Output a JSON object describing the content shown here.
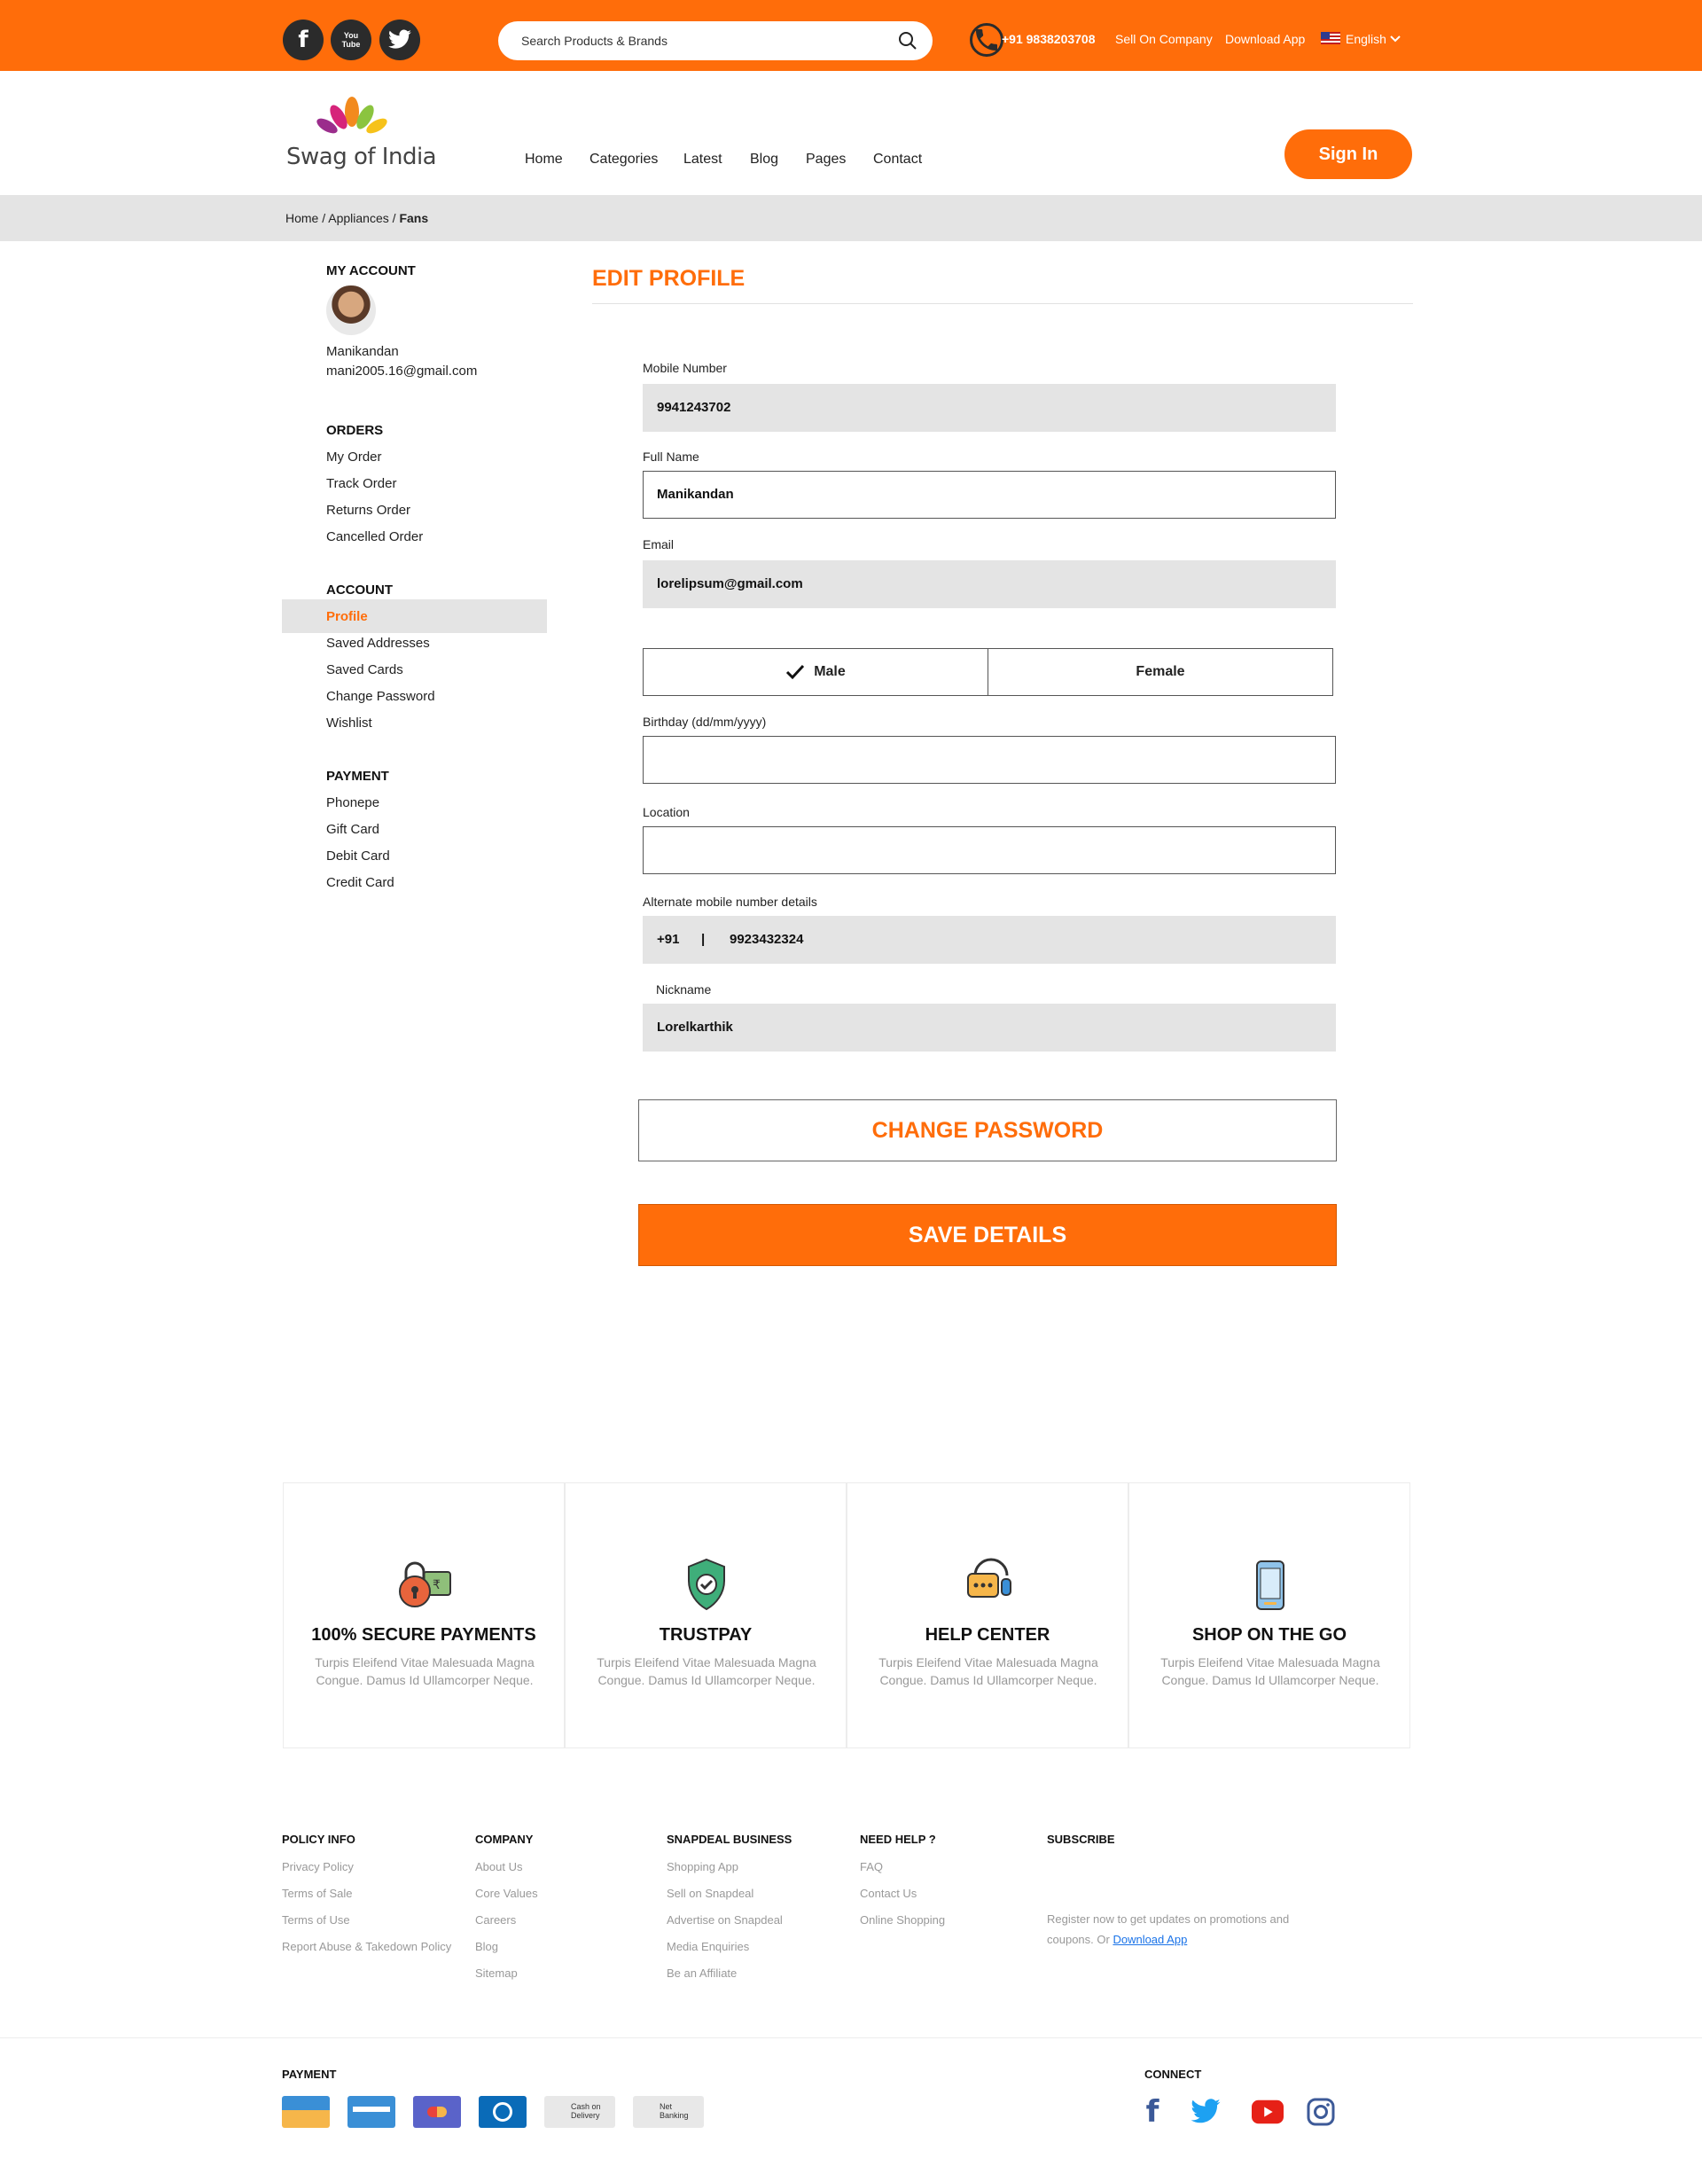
{
  "colors": {
    "brand": "#ff6d0a",
    "dark": "#2b2b2b",
    "field_bg": "#e4e4e4"
  },
  "topbar": {
    "social": [
      {
        "icon": "facebook-icon",
        "glyph": "f"
      },
      {
        "icon": "youtube-icon",
        "glyph": "You Tube"
      },
      {
        "icon": "twitter-icon",
        "glyph": "t"
      }
    ],
    "search_placeholder": "Search Products & Brands",
    "phone": "+91 9838203708",
    "sell": "Sell On Company",
    "download": "Download App",
    "language": "English"
  },
  "header": {
    "logo_text": "Swag of India",
    "nav": [
      "Home",
      "Categories",
      "Latest",
      "Blog",
      "Pages",
      "Contact"
    ],
    "signin": "Sign In"
  },
  "breadcrumb": {
    "home": "Home",
    "sep": " / ",
    "section": "Appliances",
    "current": "Fans"
  },
  "sidebar": {
    "my_account": "MY ACCOUNT",
    "user_name": "Manikandan",
    "user_email": "mani2005.16@gmail.com",
    "orders_heading": "ORDERS",
    "orders": [
      "My Order",
      "Track Order",
      "Returns Order",
      "Cancelled Order"
    ],
    "account_heading": "ACCOUNT",
    "account": [
      "Profile",
      "Saved Addresses",
      "Saved Cards",
      "Change Password",
      "Wishlist"
    ],
    "payment_heading": "PAYMENT",
    "payment": [
      "Phonepe",
      "Gift Card",
      "Debit Card",
      "Credit Card"
    ]
  },
  "form": {
    "title": "EDIT PROFILE",
    "mobile_label": "Mobile Number",
    "mobile_value": "9941243702",
    "fullname_label": "Full Name",
    "fullname_value": "Manikandan",
    "email_label": "Email",
    "email_value": "lorelipsum@gmail.com",
    "gender_male": "Male",
    "gender_female": "Female",
    "birthday_label": "Birthday (dd/mm/yyyy)",
    "location_label": "Location",
    "alt_label": "Alternate mobile number details",
    "alt_code": "+91",
    "alt_sep": "|",
    "alt_number": "9923432324",
    "nickname_label": "Nickname",
    "nickname_value": "Lorelkarthik",
    "change_password": "CHANGE PASSWORD",
    "save": "SAVE DETAILS"
  },
  "features": [
    {
      "icon": "secure-lock-icon",
      "title": "100% SECURE PAYMENTS",
      "desc": "Turpis Eleifend Vitae Malesuada Magna Congue. Damus Id Ullamcorper Neque."
    },
    {
      "icon": "shield-check-icon",
      "title": "TRUSTPAY",
      "desc": "Turpis Eleifend Vitae Malesuada Magna Congue. Damus Id Ullamcorper Neque."
    },
    {
      "icon": "help-chat-icon",
      "title": "HELP CENTER",
      "desc": "Turpis Eleifend Vitae Malesuada Magna Congue. Damus Id Ullamcorper Neque."
    },
    {
      "icon": "mobile-phone-icon",
      "title": "SHOP ON THE GO",
      "desc": "Turpis Eleifend Vitae Malesuada Magna Congue. Damus Id Ullamcorper Neque."
    }
  ],
  "footer": {
    "policy_heading": "POLICY INFO",
    "policy": [
      "Privacy Policy",
      "Terms of Sale",
      "Terms of Use",
      "Report Abuse & Takedown Policy"
    ],
    "company_heading": "COMPANY",
    "company": [
      "About Us",
      "Core Values",
      "Careers",
      "Blog",
      "Sitemap"
    ],
    "business_heading": "SNAPDEAL BUSINESS",
    "business": [
      "Shopping App",
      "Sell on Snapdeal",
      "Advertise on Snapdeal",
      "Media Enquiries",
      "Be an Affiliate"
    ],
    "help_heading": "NEED HELP ?",
    "help": [
      "FAQ",
      "Contact Us",
      "Online Shopping"
    ],
    "subscribe_heading": "SUBSCRIBE",
    "subscribe_text": "Register now to get updates on promotions and coupons. Or",
    "subscribe_link": "Download App",
    "payment_heading": "PAYMENT",
    "payment_methods": [
      {
        "icon": "card-icon",
        "label": ""
      },
      {
        "icon": "card-icon",
        "label": ""
      },
      {
        "icon": "mastercard-icon",
        "label": ""
      },
      {
        "icon": "diners-icon",
        "label": ""
      },
      {
        "icon": "cash-on-delivery-icon",
        "label": "Cash on Delivery"
      },
      {
        "icon": "net-banking-icon",
        "label": "Net Banking"
      }
    ],
    "connect_heading": "CONNECT",
    "connect": [
      "facebook-icon",
      "twitter-icon",
      "youtube-icon",
      "instagram-icon"
    ]
  }
}
